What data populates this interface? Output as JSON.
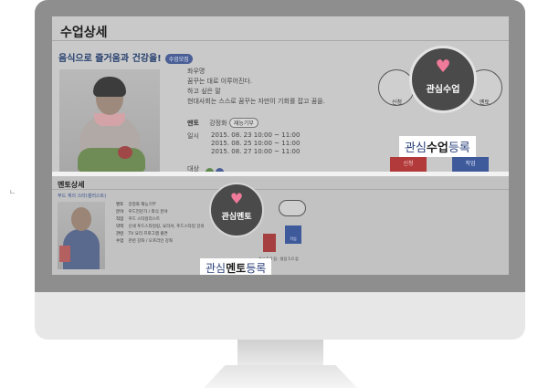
{
  "side_mark": "ㄴ",
  "course_panel": {
    "title": "수업상세",
    "course_title": "음식으로 즐거움과 건강을!",
    "badge": "수업모집",
    "bio": [
      "좌우명",
      "꿈꾸는 대로 이루어진다.",
      "하고 싶은 말",
      "현대사회는 스스로 꿈꾸는 자만이 기회를 잡고 꿈을."
    ],
    "mentor_label": "멘토",
    "mentor_name": "강정화",
    "mentor_tag": "재능기부",
    "schedule_label": "일시",
    "schedule": [
      "2015. 08. 23 10:00 ~ 11:00",
      "2015. 08. 25 10:00 ~ 11:00",
      "2015. 08. 27 10:00 ~ 11:00"
    ],
    "target_label": "대상",
    "apply_label": "신청",
    "mentor_right_label": "멘토",
    "red_button": "신청",
    "blue_button": "작업"
  },
  "mentor_panel": {
    "title": "멘토상세",
    "subtitle": "푸드 계의 스타(셀러스트)",
    "rows": [
      {
        "k": "멘토",
        "v": "강정화  재능기부"
      },
      {
        "k": "분야",
        "v": "푸드전문가 / 외식 분야"
      },
      {
        "k": "직업",
        "v": "푸드 스타일리스트"
      },
      {
        "k": "약력",
        "v": "신세 푸드스타일링, 요리서, 푸드스타일 강의"
      },
      {
        "k": "관련",
        "v": "TV 요리 프로그램 출연"
      },
      {
        "k": "수업",
        "v": "관련 강좌 / 오프라인 강좌"
      }
    ],
    "blue_button": "작업",
    "tags": "최고 5.0 점 · 평점 5.0 점"
  },
  "overlays": {
    "favorite_class": "관심수업",
    "favorite_mentor": "관심멘토",
    "callout_class_a": "관심",
    "callout_class_b": "수업",
    "callout_class_c": "등록",
    "callout_mentor_a": "관심",
    "callout_mentor_b": "멘토",
    "callout_mentor_c": "등록"
  },
  "colors": {
    "heart": "#f07a9a",
    "navy": "#2a3f7a",
    "red_button": "#b33a3a",
    "blue_button": "#3e5a9a",
    "bezel": "#8e8e8e"
  }
}
